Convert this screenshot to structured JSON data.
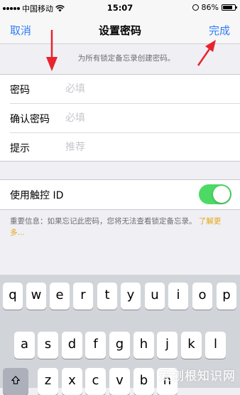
{
  "status_bar": {
    "carrier": "中国移动",
    "time": "15:07",
    "battery": "86%",
    "battery_level": 0.86
  },
  "nav": {
    "cancel_label": "取消",
    "title": "设置密码",
    "done_label": "完成"
  },
  "header_note": "为所有锁定备忘录创建密码。",
  "form": {
    "rows": [
      {
        "label": "密码",
        "placeholder": "必填",
        "value": ""
      },
      {
        "label": "确认密码",
        "placeholder": "必填",
        "value": ""
      },
      {
        "label": "提示",
        "placeholder": "推荐",
        "value": ""
      }
    ]
  },
  "touch_id": {
    "label": "使用触控 ID",
    "enabled": true
  },
  "footer": {
    "text": "重要信息：如果忘记此密码，您将无法查看锁定备忘录。",
    "link": "了解更多..."
  },
  "keyboard": {
    "row1": [
      "q",
      "w",
      "e",
      "r",
      "t",
      "y",
      "u",
      "i",
      "o",
      "p"
    ],
    "row2": [
      "a",
      "s",
      "d",
      "f",
      "g",
      "h",
      "j",
      "k",
      "l"
    ],
    "row3": [
      "z",
      "x",
      "c",
      "v",
      "b",
      "n"
    ]
  },
  "watermark": "爱刨根知识网",
  "colors": {
    "accent": "#2f7cf6",
    "toggle_on": "#4cd964",
    "link": "#e6a817",
    "annotation_arrow": "#e8232e"
  }
}
